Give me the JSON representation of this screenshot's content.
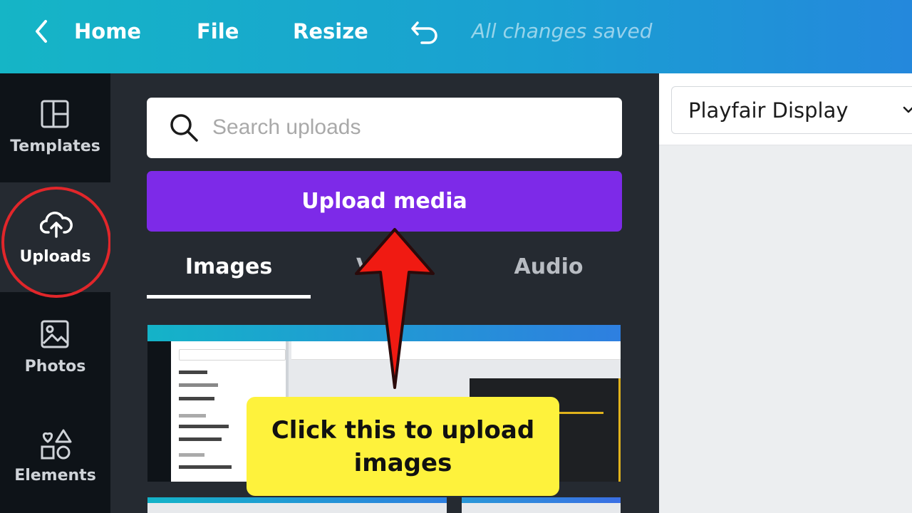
{
  "topbar": {
    "back_icon": "chevron-left-icon",
    "home_label": "Home",
    "file_label": "File",
    "resize_label": "Resize",
    "undo_icon": "undo-icon",
    "status_text": "All changes saved"
  },
  "sidebar": {
    "items": [
      {
        "label": "Templates",
        "icon": "templates-icon"
      },
      {
        "label": "Uploads",
        "icon": "cloud-upload-icon",
        "active": true
      },
      {
        "label": "Photos",
        "icon": "photo-icon"
      },
      {
        "label": "Elements",
        "icon": "shapes-icon"
      }
    ]
  },
  "panel": {
    "search_placeholder": "Search uploads",
    "upload_button_label": "Upload media",
    "tabs": [
      {
        "label": "Images",
        "active": true
      },
      {
        "label": "V"
      },
      {
        "label": "Audio"
      }
    ]
  },
  "editor": {
    "font_family_value": "Playfair Display"
  },
  "annotation": {
    "callout_text": "Click this to upload images",
    "highlight_color": "#e1262a",
    "callout_color": "#fef23c"
  },
  "colors": {
    "accent_purple": "#7d2ae8",
    "topbar_start": "#15b5c6",
    "topbar_end": "#2488dc"
  }
}
